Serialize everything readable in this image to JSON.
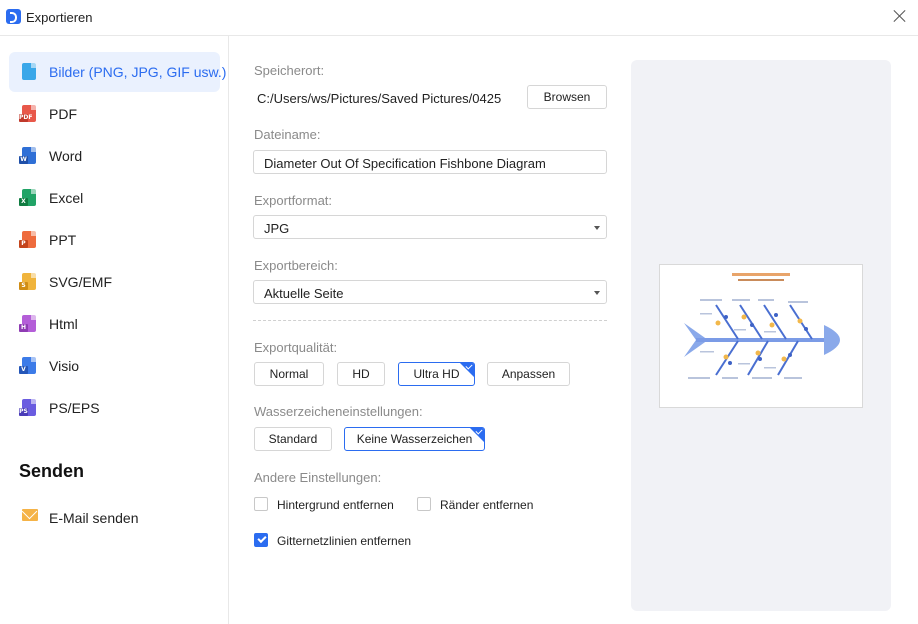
{
  "window": {
    "title": "Exportieren"
  },
  "sidebar": {
    "items": [
      {
        "label": "Bilder (PNG, JPG, GIF usw.)",
        "icon": "image-file-icon",
        "color": "#3aa7e9",
        "tag": "",
        "active": true
      },
      {
        "label": "PDF",
        "icon": "pdf-file-icon",
        "color": "#e8584a",
        "tag": "PDF",
        "active": false
      },
      {
        "label": "Word",
        "icon": "word-file-icon",
        "color": "#2f6fd6",
        "tag": "W",
        "active": false
      },
      {
        "label": "Excel",
        "icon": "excel-file-icon",
        "color": "#21a366",
        "tag": "X",
        "active": false
      },
      {
        "label": "PPT",
        "icon": "ppt-file-icon",
        "color": "#ee6b3d",
        "tag": "P",
        "active": false
      },
      {
        "label": "SVG/EMF",
        "icon": "svg-file-icon",
        "color": "#f0b43c",
        "tag": "S",
        "active": false
      },
      {
        "label": "Html",
        "icon": "html-file-icon",
        "color": "#b45ed8",
        "tag": "H",
        "active": false
      },
      {
        "label": "Visio",
        "icon": "visio-file-icon",
        "color": "#3c7be8",
        "tag": "V",
        "active": false
      },
      {
        "label": "PS/EPS",
        "icon": "ps-file-icon",
        "color": "#6a5ce0",
        "tag": "PS",
        "active": false
      }
    ],
    "send_title": "Senden",
    "email_label": "E-Mail senden"
  },
  "form": {
    "location_label": "Speicherort:",
    "location_path": "C:/Users/ws/Pictures/Saved Pictures/0425",
    "browse_label": "Browsen",
    "filename_label": "Dateiname:",
    "filename_value": "Diameter Out Of Specification Fishbone Diagram",
    "format_label": "Exportformat:",
    "format_value": "JPG",
    "range_label": "Exportbereich:",
    "range_value": "Aktuelle Seite",
    "quality_label": "Exportqualität:",
    "quality_options": [
      "Normal",
      "HD",
      "Ultra HD",
      "Anpassen"
    ],
    "quality_selected": "Ultra HD",
    "watermark_label": "Wasserzeicheneinstellungen:",
    "watermark_options": [
      "Standard",
      "Keine Wasserzeichen"
    ],
    "watermark_selected": "Keine Wasserzeichen",
    "other_label": "Andere Einstellungen:",
    "options": [
      {
        "label": "Hintergrund entfernen",
        "checked": false
      },
      {
        "label": "Ränder entfernen",
        "checked": false
      },
      {
        "label": "Gitternetzlinien entfernen",
        "checked": true
      }
    ]
  },
  "colors": {
    "accent": "#2b6cf0",
    "active_bg": "#eaf1fe",
    "preview_bg": "#f1f2f6"
  }
}
